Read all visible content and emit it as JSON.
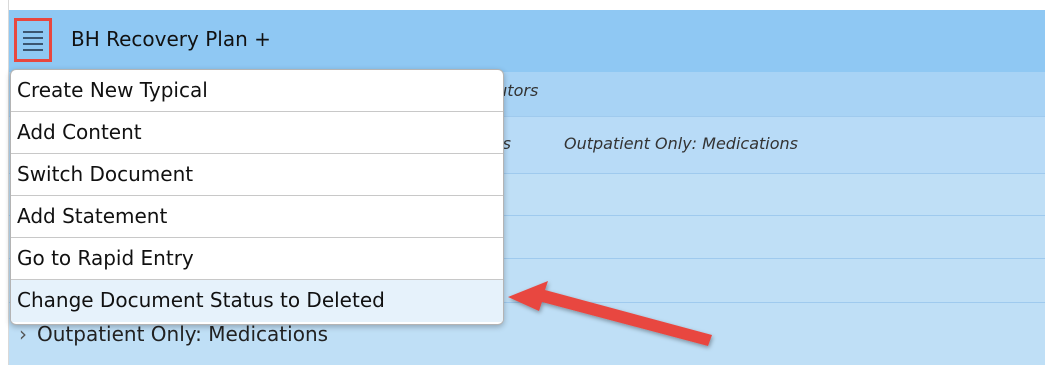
{
  "header": {
    "title": "BH Recovery Plan +"
  },
  "tabs_partial": {
    "contributors": "butors"
  },
  "filters_partial": {
    "first": "ms",
    "second": "Outpatient Only: Medications"
  },
  "menu": {
    "items": [
      {
        "label": "Create New Typical"
      },
      {
        "label": "Add Content"
      },
      {
        "label": "Switch Document"
      },
      {
        "label": "Add Statement"
      },
      {
        "label": "Go to Rapid Entry"
      },
      {
        "label": "Change Document Status to Deleted"
      }
    ]
  },
  "content": {
    "section_label": "Outpatient Only: Medications"
  },
  "icons": {
    "menu": "hamburger-menu-icon",
    "chevron": "chevron-right-icon",
    "annotation": "red-arrow"
  },
  "colors": {
    "header": "#8fc8f3",
    "panel": "#bfdff6",
    "highlight": "#e8473f"
  }
}
